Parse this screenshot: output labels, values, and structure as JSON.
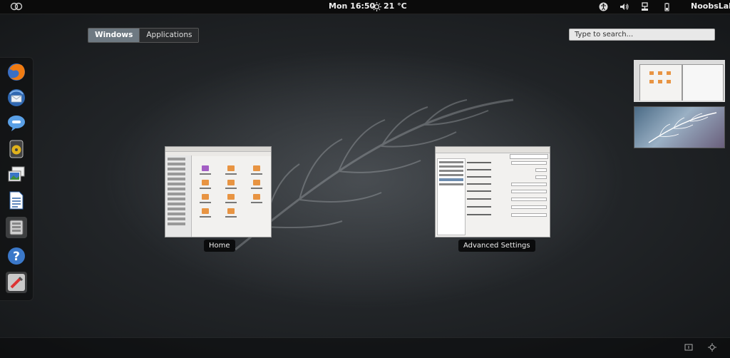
{
  "top_panel": {
    "clock": "Mon 16:50",
    "weather": "21 °C",
    "user": "NoobsLab",
    "icons": [
      "activities-icon",
      "weather-icon",
      "accessibility-icon",
      "volume-icon",
      "network-icon",
      "battery-icon"
    ]
  },
  "view_selector": {
    "windows": "Windows",
    "applications": "Applications"
  },
  "search": {
    "placeholder": "Type to search..."
  },
  "dash": {
    "items": [
      "firefox-icon",
      "thunderbird-icon",
      "empathy-icon",
      "rhythmbox-icon",
      "shotwell-icon",
      "libreoffice-writer-icon",
      "files-icon",
      "help-icon",
      "settings-icon"
    ]
  },
  "windows": [
    {
      "caption": "Home"
    },
    {
      "caption": "Advanced Settings"
    }
  ],
  "colors": {
    "panel": "#0b0b0b",
    "accent": "#6e7982",
    "folder": "#e89442"
  }
}
